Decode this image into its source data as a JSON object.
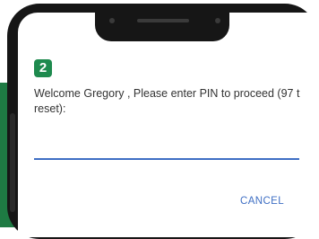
{
  "dialog": {
    "app_icon_glyph": "2",
    "message": "Welcome Gregory , Please enter PIN to proceed (97 t reset):",
    "pin_value": "",
    "cancel_label": "CANCEL"
  },
  "colors": {
    "accent": "#3f6fc4",
    "brand_green": "#1e7a43",
    "icon_green": "#1e8a4e"
  }
}
